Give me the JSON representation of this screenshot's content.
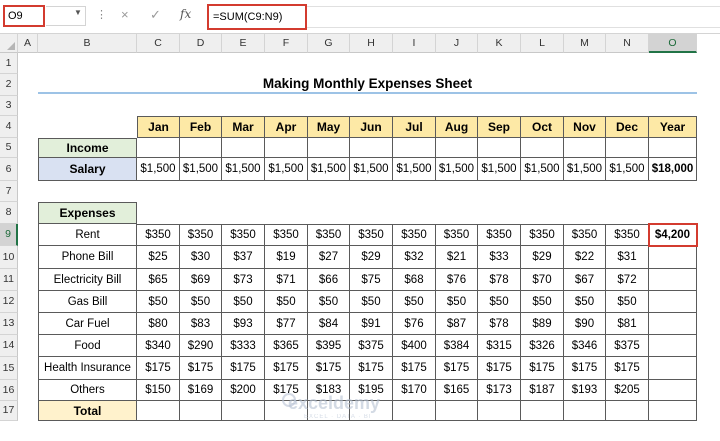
{
  "name_box": {
    "value": "O9"
  },
  "formula_bar": {
    "fx_label": "fx",
    "formula": "=SUM(C9:N9)",
    "cancel_icon": "×",
    "enter_icon": "✓"
  },
  "columns": [
    "A",
    "B",
    "C",
    "D",
    "E",
    "F",
    "G",
    "H",
    "I",
    "J",
    "K",
    "L",
    "M",
    "N",
    "O"
  ],
  "rows": [
    "1",
    "2",
    "3",
    "4",
    "5",
    "6",
    "7",
    "8",
    "9",
    "10",
    "11",
    "12",
    "13",
    "14",
    "15",
    "16",
    "17"
  ],
  "selected_cell": {
    "column": "O",
    "row": "9"
  },
  "sheet": {
    "title": "Making Monthly Expenses Sheet",
    "months": [
      "Jan",
      "Feb",
      "Mar",
      "Apr",
      "May",
      "Jun",
      "Jul",
      "Aug",
      "Sep",
      "Oct",
      "Nov",
      "Dec"
    ],
    "year_label": "Year",
    "income_label": "Income",
    "salary": {
      "label": "Salary",
      "values": [
        "$1,500",
        "$1,500",
        "$1,500",
        "$1,500",
        "$1,500",
        "$1,500",
        "$1,500",
        "$1,500",
        "$1,500",
        "$1,500",
        "$1,500",
        "$1,500"
      ],
      "year": "$18,000"
    },
    "expenses_label": "Expenses",
    "expenses": [
      {
        "label": "Rent",
        "values": [
          "$350",
          "$350",
          "$350",
          "$350",
          "$350",
          "$350",
          "$350",
          "$350",
          "$350",
          "$350",
          "$350",
          "$350"
        ],
        "year": "$4,200"
      },
      {
        "label": "Phone Bill",
        "values": [
          "$25",
          "$30",
          "$37",
          "$19",
          "$27",
          "$29",
          "$32",
          "$21",
          "$33",
          "$29",
          "$22",
          "$31"
        ],
        "year": ""
      },
      {
        "label": "Electricity Bill",
        "values": [
          "$65",
          "$69",
          "$73",
          "$71",
          "$66",
          "$75",
          "$68",
          "$76",
          "$78",
          "$70",
          "$67",
          "$72"
        ],
        "year": ""
      },
      {
        "label": "Gas Bill",
        "values": [
          "$50",
          "$50",
          "$50",
          "$50",
          "$50",
          "$50",
          "$50",
          "$50",
          "$50",
          "$50",
          "$50",
          "$50"
        ],
        "year": ""
      },
      {
        "label": "Car Fuel",
        "values": [
          "$80",
          "$83",
          "$93",
          "$77",
          "$84",
          "$91",
          "$76",
          "$87",
          "$78",
          "$89",
          "$90",
          "$81"
        ],
        "year": ""
      },
      {
        "label": "Food",
        "values": [
          "$340",
          "$290",
          "$333",
          "$365",
          "$395",
          "$375",
          "$400",
          "$384",
          "$315",
          "$326",
          "$346",
          "$375"
        ],
        "year": ""
      },
      {
        "label": "Health Insurance",
        "values": [
          "$175",
          "$175",
          "$175",
          "$175",
          "$175",
          "$175",
          "$175",
          "$175",
          "$175",
          "$175",
          "$175",
          "$175"
        ],
        "year": ""
      },
      {
        "label": "Others",
        "values": [
          "$150",
          "$169",
          "$200",
          "$175",
          "$183",
          "$195",
          "$170",
          "$165",
          "$173",
          "$187",
          "$193",
          "$205"
        ],
        "year": ""
      }
    ],
    "total_label": "Total"
  },
  "watermark": {
    "name": "exceldemy",
    "tagline": "EXCEL · DATA · BI"
  },
  "colors": {
    "selection_red": "#d33b2f",
    "month_header": "#fde9a6",
    "green_label": "#e2efda",
    "blue_label": "#d9e1f2",
    "yellow_label": "#fff2cc",
    "title_underline": "#9dc3e6"
  }
}
